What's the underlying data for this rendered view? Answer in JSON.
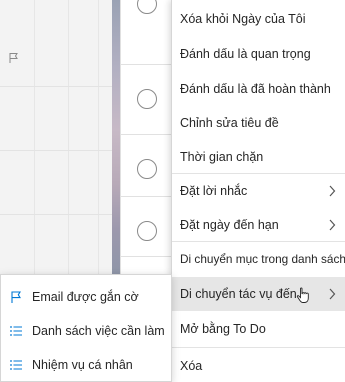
{
  "menu": {
    "items": [
      {
        "label": "Xóa khỏi Ngày của Tôi",
        "has_submenu": false
      },
      {
        "label": "Đánh dấu là quan trọng",
        "has_submenu": false
      },
      {
        "label": "Đánh dấu là đã hoàn thành",
        "has_submenu": false
      },
      {
        "label": "Chỉnh sửa tiêu đề",
        "has_submenu": false
      },
      {
        "label": "Thời gian chặn",
        "has_submenu": false
      },
      {
        "label": "Đặt lời nhắc",
        "has_submenu": true
      },
      {
        "label": "Đặt ngày đến hạn",
        "has_submenu": true
      },
      {
        "label": "Di chuyển mục trong danh sách",
        "has_submenu": false
      },
      {
        "label": "Di chuyển tác vụ đến...",
        "has_submenu": true,
        "active": true
      },
      {
        "label": "Mở bằng To Do",
        "has_submenu": false
      },
      {
        "label": "Xóa",
        "has_submenu": false
      }
    ]
  },
  "submenu": {
    "items": [
      {
        "label": "Email được gắn cờ",
        "icon": "flag-icon"
      },
      {
        "label": "Danh sách việc cần làm",
        "icon": "list-icon"
      },
      {
        "label": "Nhiệm vụ cá nhân",
        "icon": "list-icon"
      }
    ]
  },
  "colors": {
    "accent": "#0078d4",
    "menu_bg": "#ffffff",
    "hover_bg": "#e6e6e6",
    "text": "#262626"
  }
}
